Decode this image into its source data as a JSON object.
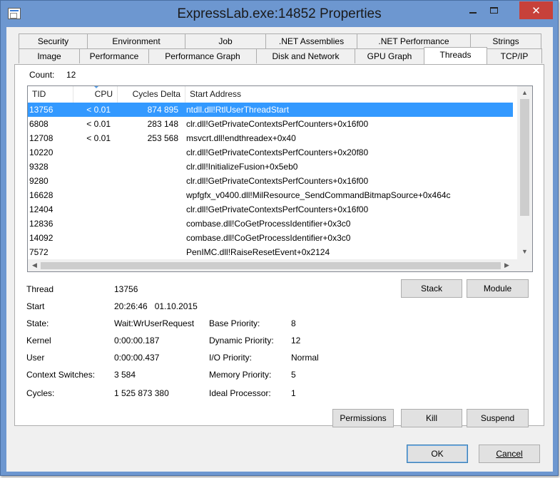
{
  "window": {
    "title": "ExpressLab.exe:14852 Properties",
    "min_icon": "minimize-icon",
    "max_icon": "maximize-icon",
    "close_icon": "close-icon",
    "close_glyph": "✕"
  },
  "tabs": {
    "row1": [
      "Security",
      "Environment",
      "Job",
      ".NET Assemblies",
      ".NET Performance",
      "Strings"
    ],
    "row2": [
      "Image",
      "Performance",
      "Performance Graph",
      "Disk and Network",
      "GPU Graph",
      "Threads",
      "TCP/IP"
    ],
    "active": "Threads"
  },
  "threads": {
    "count_label": "Count:",
    "count_value": "12",
    "columns": [
      "TID",
      "CPU",
      "Cycles Delta",
      "Start Address"
    ],
    "sorted_column": "CPU",
    "rows": [
      {
        "tid": "13756",
        "cpu": "< 0.01",
        "cycles": "874 895",
        "address": "ntdll.dll!RtlUserThreadStart",
        "selected": true
      },
      {
        "tid": "6808",
        "cpu": "< 0.01",
        "cycles": "283 148",
        "address": "clr.dll!GetPrivateContextsPerfCounters+0x16f00"
      },
      {
        "tid": "12708",
        "cpu": "< 0.01",
        "cycles": "253 568",
        "address": "msvcrt.dll!endthreadex+0x40"
      },
      {
        "tid": "10220",
        "cpu": "",
        "cycles": "",
        "address": "clr.dll!GetPrivateContextsPerfCounters+0x20f80"
      },
      {
        "tid": "9328",
        "cpu": "",
        "cycles": "",
        "address": "clr.dll!InitializeFusion+0x5eb0"
      },
      {
        "tid": "9280",
        "cpu": "",
        "cycles": "",
        "address": "clr.dll!GetPrivateContextsPerfCounters+0x16f00"
      },
      {
        "tid": "16628",
        "cpu": "",
        "cycles": "",
        "address": "wpfgfx_v0400.dll!MilResource_SendCommandBitmapSource+0x464c"
      },
      {
        "tid": "12404",
        "cpu": "",
        "cycles": "",
        "address": "clr.dll!GetPrivateContextsPerfCounters+0x16f00"
      },
      {
        "tid": "12836",
        "cpu": "",
        "cycles": "",
        "address": "combase.dll!CoGetProcessIdentifier+0x3c0"
      },
      {
        "tid": "14092",
        "cpu": "",
        "cycles": "",
        "address": "combase.dll!CoGetProcessIdentifier+0x3c0"
      },
      {
        "tid": "7572",
        "cpu": "",
        "cycles": "",
        "address": "PenIMC.dll!RaiseResetEvent+0x2124"
      }
    ]
  },
  "details": {
    "thread_label": "Thread",
    "thread_value": "13756",
    "start_label": "Start",
    "start_value": "20:26:46   01.10.2015",
    "state_label": "State:",
    "state_value": "Wait:WrUserRequest",
    "kernel_label": "Kernel",
    "kernel_value": "0:00:00.187",
    "user_label": "User",
    "user_value": "0:00:00.437",
    "ctxsw_label": "Context Switches:",
    "ctxsw_value": "3 584",
    "cycles_label": "Cycles:",
    "cycles_value": "1 525 873 380",
    "base_prio_label": "Base Priority:",
    "base_prio_value": "8",
    "dyn_prio_label": "Dynamic Priority:",
    "dyn_prio_value": "12",
    "io_prio_label": "I/O Priority:",
    "io_prio_value": "Normal",
    "mem_prio_label": "Memory Priority:",
    "mem_prio_value": "5",
    "ideal_proc_label": "Ideal Processor:",
    "ideal_proc_value": "1"
  },
  "buttons": {
    "stack": "Stack",
    "module": "Module",
    "permissions": "Permissions",
    "kill": "Kill",
    "suspend": "Suspend",
    "ok": "OK",
    "cancel": "Cancel"
  },
  "scroll_glyphs": {
    "up": "▲",
    "down": "▼",
    "left": "◀",
    "right": "▶"
  },
  "colors": {
    "selection": "#3399ff",
    "title_bar": "#6d97d0",
    "close_button": "#c7413a"
  }
}
